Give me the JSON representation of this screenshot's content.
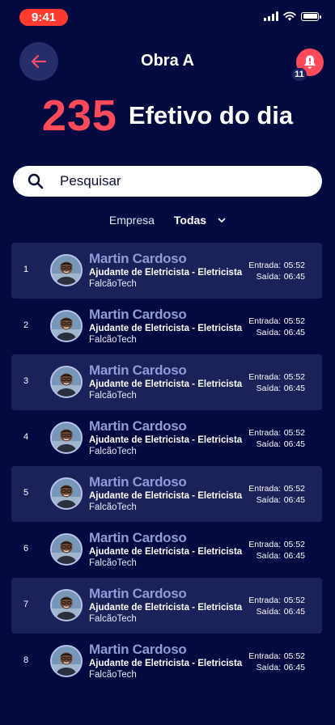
{
  "status_bar": {
    "time": "9:41"
  },
  "header": {
    "title": "Obra A",
    "notification_count": "11"
  },
  "hero": {
    "count": "235",
    "label": "Efetivo do dia"
  },
  "search": {
    "placeholder": "Pesquisar"
  },
  "filter": {
    "label": "Empresa",
    "value": "Todas"
  },
  "workers": [
    {
      "index": "1",
      "name": "Martin Cardoso",
      "role": "Ajudante de Eletricista - Eletricista",
      "company": "FalcãoTech",
      "entry_label": "Entrada:",
      "entry_time": "05:52",
      "exit_label": "Saída:",
      "exit_time": "06:45"
    },
    {
      "index": "2",
      "name": "Martin Cardoso",
      "role": "Ajudante de Eletricista - Eletricista",
      "company": "FalcãoTech",
      "entry_label": "Entrada:",
      "entry_time": "05:52",
      "exit_label": "Saída:",
      "exit_time": "06:45"
    },
    {
      "index": "3",
      "name": "Martin Cardoso",
      "role": "Ajudante de Eletricista - Eletricista",
      "company": "FalcãoTech",
      "entry_label": "Entrada:",
      "entry_time": "05:52",
      "exit_label": "Saída:",
      "exit_time": "06:45"
    },
    {
      "index": "4",
      "name": "Martin Cardoso",
      "role": "Ajudante de Eletricista - Eletricista",
      "company": "FalcãoTech",
      "entry_label": "Entrada:",
      "entry_time": "05:52",
      "exit_label": "Saída:",
      "exit_time": "06:45"
    },
    {
      "index": "5",
      "name": "Martin Cardoso",
      "role": "Ajudante de Eletricista - Eletricista",
      "company": "FalcãoTech",
      "entry_label": "Entrada:",
      "entry_time": "05:52",
      "exit_label": "Saída:",
      "exit_time": "06:45"
    },
    {
      "index": "6",
      "name": "Martin Cardoso",
      "role": "Ajudante de Eletricista - Eletricista",
      "company": "FalcãoTech",
      "entry_label": "Entrada:",
      "entry_time": "05:52",
      "exit_label": "Saída:",
      "exit_time": "06:45"
    },
    {
      "index": "7",
      "name": "Martin Cardoso",
      "role": "Ajudante de Eletricista - Eletricista",
      "company": "FalcãoTech",
      "entry_label": "Entrada:",
      "entry_time": "05:52",
      "exit_label": "Saída:",
      "exit_time": "06:45"
    },
    {
      "index": "8",
      "name": "Martin Cardoso",
      "role": "Ajudante de Eletricista - Eletricista",
      "company": "FalcãoTech",
      "entry_label": "Entrada:",
      "entry_time": "05:52",
      "exit_label": "Saída:",
      "exit_time": "06:45"
    }
  ],
  "colors": {
    "background": "#04093f",
    "accent": "#ff4a5a",
    "row_alt": "#1b2159",
    "name": "#8e9bd7",
    "back_button": "#252d6b"
  },
  "icons": {
    "back": "arrow-left-icon",
    "notification": "bell-alert-icon",
    "search": "search-icon",
    "dropdown": "chevron-down-icon",
    "signal": "cellular-signal-icon",
    "wifi": "wifi-icon",
    "battery": "battery-icon"
  }
}
